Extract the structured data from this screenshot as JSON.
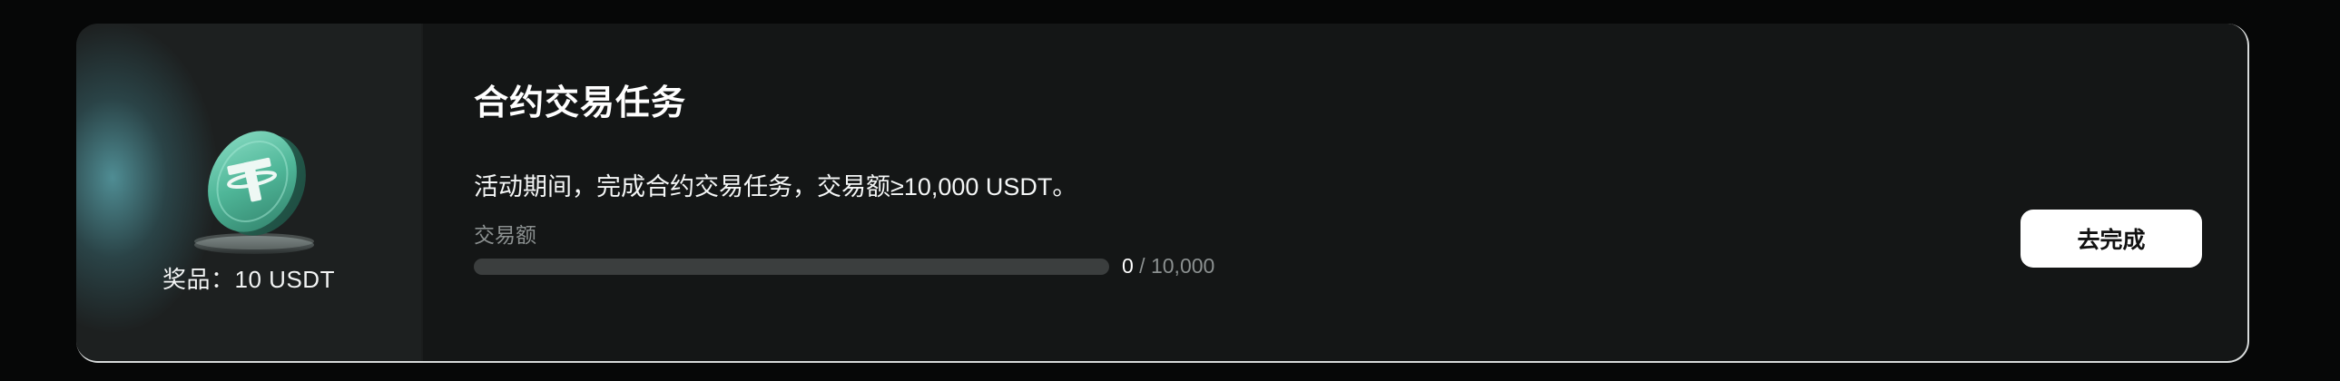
{
  "task": {
    "title": "合约交易任务",
    "description": "活动期间，完成合约交易任务，交易额≥10,000 USDT。",
    "progress": {
      "label": "交易额",
      "current": "0",
      "separator": " / ",
      "target": "10,000",
      "fraction": 0
    },
    "button_label": "去完成"
  },
  "reward": {
    "label": "奖品：10 USDT",
    "icon": "usdt-coin-icon"
  },
  "colors": {
    "background": "#060707",
    "card": "#141616",
    "reward_panel": "#1d2020",
    "coin": "#59c3a8",
    "button": "#ffffff"
  }
}
